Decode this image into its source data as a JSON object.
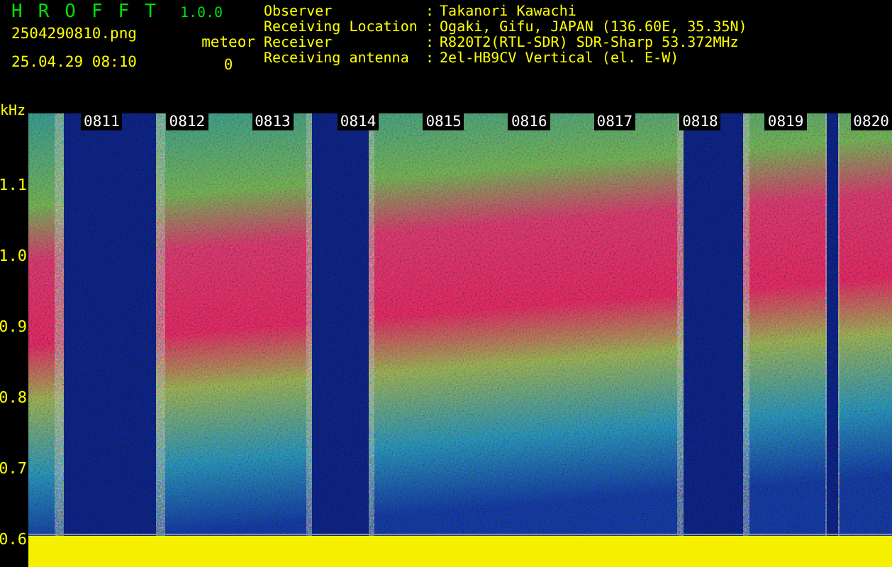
{
  "app": {
    "title": "HROFFT",
    "version": "1.0.0",
    "filename": "2504290810.png",
    "datetime": "25.04.29 08:10",
    "counter_label": "meteor",
    "counter_value": "0"
  },
  "station_info": [
    {
      "label": "Observer",
      "separator": ":",
      "value": "Takanori Kawachi"
    },
    {
      "label": "Receiving Location",
      "separator": ":",
      "value": "Ogaki, Gifu, JAPAN (136.60E, 35.35N)"
    },
    {
      "label": "Receiver",
      "separator": ":",
      "value": "R820T2(RTL-SDR) SDR-Sharp 53.372MHz"
    },
    {
      "label": "Receiving antenna",
      "separator": ":",
      "value": "2el-HB9CV Vertical (el. E-W)"
    }
  ],
  "spectrogram": {
    "y_unit": "kHz",
    "y_labels": [
      "1.1",
      "1.0",
      "0.9",
      "0.8",
      "0.7",
      "0.6"
    ],
    "time_labels": [
      "0811",
      "0812",
      "0813",
      "0814",
      "0815",
      "0816",
      "0817",
      "0818",
      "0819",
      "0820"
    ]
  }
}
